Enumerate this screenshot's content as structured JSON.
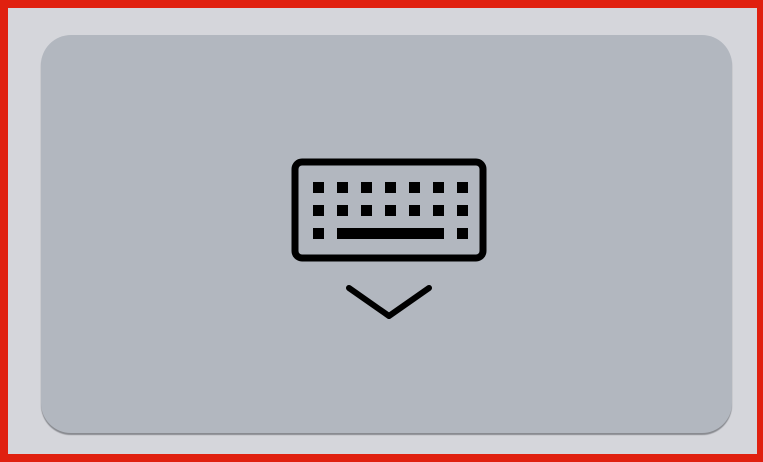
{
  "keyboard_key": {
    "icon": "keyboard-dismiss-icon",
    "label": "",
    "colors": {
      "frame_border": "#e0200f",
      "frame_background": "#d5d6db",
      "key_background": "#b2b7bf",
      "key_shadow": "#898b90",
      "icon": "#000000"
    }
  }
}
